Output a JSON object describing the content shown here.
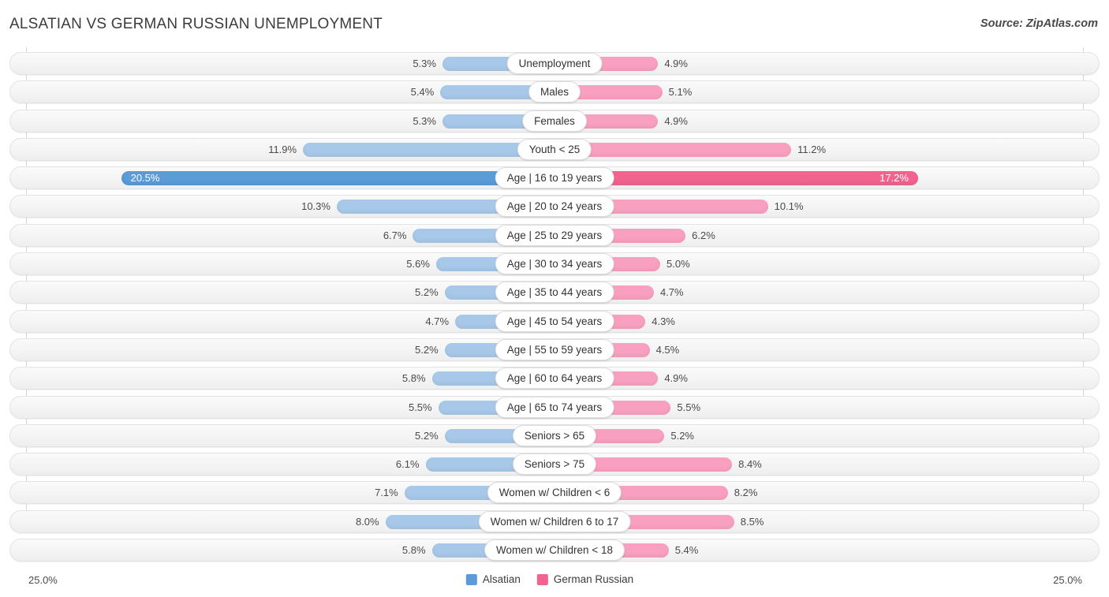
{
  "header": {
    "title": "ALSATIAN VS GERMAN RUSSIAN UNEMPLOYMENT",
    "source": "Source: ZipAtlas.com"
  },
  "axis": {
    "max_left_label": "25.0%",
    "max_right_label": "25.0%",
    "max_value": 25.0
  },
  "legend": {
    "items": [
      {
        "label": "Alsatian",
        "color": "#5b9bd8"
      },
      {
        "label": "German Russian",
        "color": "#f2638f"
      }
    ]
  },
  "colors": {
    "left_light": "#a8c8ea",
    "left_strong": "#5b9bd8",
    "right_light": "#f9a0c0",
    "right_strong": "#f2638f"
  },
  "chart_data": {
    "type": "bar",
    "title": "ALSATIAN VS GERMAN RUSSIAN UNEMPLOYMENT",
    "subtitle": "Source: ZipAtlas.com",
    "orientation": "horizontal-diverging",
    "xlabel": "",
    "ylabel": "",
    "xlim": [
      25.0,
      25.0
    ],
    "grid": true,
    "legend_position": "bottom-center",
    "categories": [
      "Unemployment",
      "Males",
      "Females",
      "Youth < 25",
      "Age | 16 to 19 years",
      "Age | 20 to 24 years",
      "Age | 25 to 29 years",
      "Age | 30 to 34 years",
      "Age | 35 to 44 years",
      "Age | 45 to 54 years",
      "Age | 55 to 59 years",
      "Age | 60 to 64 years",
      "Age | 65 to 74 years",
      "Seniors > 65",
      "Seniors > 75",
      "Women w/ Children < 6",
      "Women w/ Children 6 to 17",
      "Women w/ Children < 18"
    ],
    "series": [
      {
        "name": "Alsatian",
        "side": "left",
        "values": [
          5.3,
          5.4,
          5.3,
          11.9,
          20.5,
          10.3,
          6.7,
          5.6,
          5.2,
          4.7,
          5.2,
          5.8,
          5.5,
          5.2,
          6.1,
          7.1,
          8.0,
          5.8
        ],
        "labels": [
          "5.3%",
          "5.4%",
          "5.3%",
          "11.9%",
          "20.5%",
          "10.3%",
          "6.7%",
          "5.6%",
          "5.2%",
          "4.7%",
          "5.2%",
          "5.8%",
          "5.5%",
          "5.2%",
          "6.1%",
          "7.1%",
          "8.0%",
          "5.8%"
        ]
      },
      {
        "name": "German Russian",
        "side": "right",
        "values": [
          4.9,
          5.1,
          4.9,
          11.2,
          17.2,
          10.1,
          6.2,
          5.0,
          4.7,
          4.3,
          4.5,
          4.9,
          5.5,
          5.2,
          8.4,
          8.2,
          8.5,
          5.4
        ],
        "labels": [
          "4.9%",
          "5.1%",
          "4.9%",
          "11.2%",
          "17.2%",
          "10.1%",
          "6.2%",
          "5.0%",
          "4.7%",
          "4.3%",
          "4.5%",
          "4.9%",
          "5.5%",
          "5.2%",
          "8.4%",
          "8.2%",
          "8.5%",
          "5.4%"
        ]
      }
    ]
  }
}
